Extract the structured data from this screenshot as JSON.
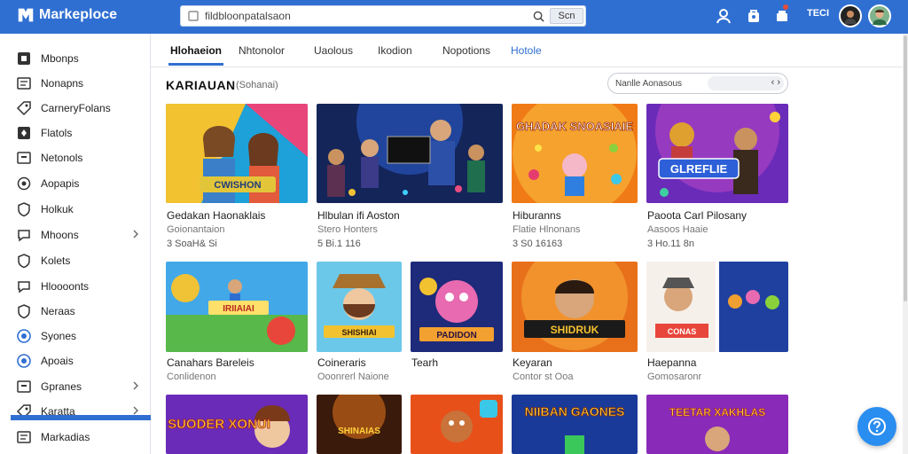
{
  "header": {
    "brand": "Markeploce",
    "search_value": "fildbloonpatalsaon",
    "search_button": "Scn",
    "notif_count": "TECI"
  },
  "sidebar": {
    "items": [
      {
        "label": "Mbonps",
        "icon": "square-icon"
      },
      {
        "label": "Nonapns",
        "icon": "card-icon"
      },
      {
        "label": "CarneryFolans",
        "icon": "tag-icon"
      },
      {
        "label": "Flatols",
        "icon": "grid-icon"
      },
      {
        "label": "Netonols",
        "icon": "box-icon"
      },
      {
        "label": "Aopapis",
        "icon": "cloud-icon"
      },
      {
        "label": "Holkuk",
        "icon": "shield-icon"
      },
      {
        "label": "Mhoons",
        "icon": "chat-icon",
        "chevron": true
      },
      {
        "label": "Kolets",
        "icon": "shield-icon"
      },
      {
        "label": "Hloooonts",
        "icon": "chat-icon"
      },
      {
        "label": "Neraas",
        "icon": "shield-icon"
      },
      {
        "label": "Syones",
        "icon": "circle-icon"
      },
      {
        "label": "Apoais",
        "icon": "circle-icon"
      },
      {
        "label": "Gpranes",
        "icon": "box-icon",
        "chevron": true
      },
      {
        "label": "Karatta",
        "icon": "tag-icon",
        "chevron": true
      },
      {
        "label": "Markadias",
        "icon": "card-icon"
      }
    ]
  },
  "tabs": [
    "Hlohaeion",
    "Nhtonolor",
    "Uaolous",
    "Ikodion",
    "Nopotions",
    "Hotole"
  ],
  "section": {
    "title": "KARIAUAN",
    "subtitle": "(Sohanai)",
    "sort_label": "Nanlle Aonasous",
    "sort_arrows": "‹ ›"
  },
  "cards_row1": [
    {
      "title": "Gedakan Haonaklais",
      "sub": "Goionantaion",
      "meta": "3 SoaH& Si"
    },
    {
      "title": "Hlbulan ifi Aoston",
      "sub": "Stero Honters",
      "meta": "5 Bi.1 116"
    },
    {
      "title": "Hiburanns",
      "sub": "Flatie Hlnonans",
      "meta": "3 S0 16163"
    },
    {
      "title": "Paoota Carl Pilosany",
      "sub": "Aasoos Haaie",
      "meta": "3 Ho.11 8n"
    }
  ],
  "cards_row2": [
    {
      "title": "Canahars Bareleis",
      "sub": "Conlidenon"
    },
    {
      "title": "Coineraris",
      "sub": "Ooonrerl Naione"
    },
    {
      "title": "Tearh",
      "sub": ""
    },
    {
      "title": "Keyaran",
      "sub": "Contor st Ooa"
    },
    {
      "title": "Haepanna",
      "sub": "Gomosaronr"
    }
  ],
  "thumb_texts": [
    "CWISHON",
    "GHADAK SNOASIAIE",
    "GLREFLIE",
    "IRIIAIAI",
    "SHISHIAI",
    "PADIDON",
    "SHIDRUK",
    "CONAS",
    "SUODER XONUI",
    "SHINAIAS",
    "NIIBAN GAONES",
    "TEETAR XAKHLAS"
  ],
  "colors": {
    "accent": "#2f6fd2",
    "help": "#2a8df0"
  }
}
